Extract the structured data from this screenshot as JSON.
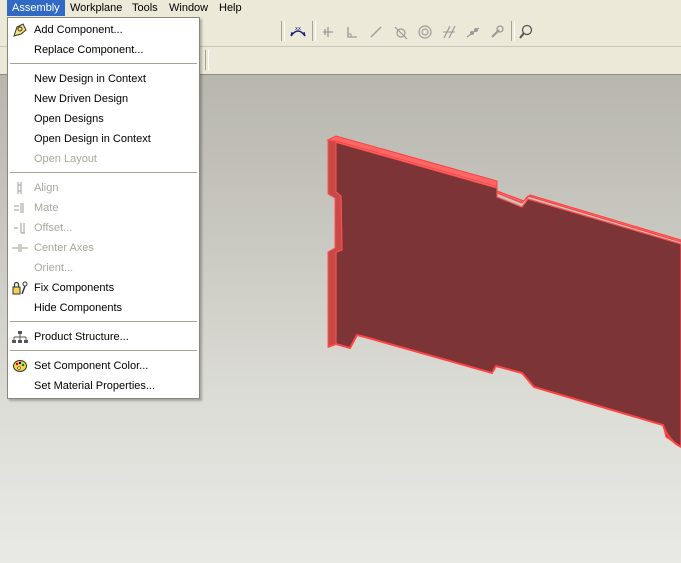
{
  "menubar": {
    "items": [
      {
        "label": "Assembly"
      },
      {
        "label": "Workplane"
      },
      {
        "label": "Tools"
      },
      {
        "label": "Window"
      },
      {
        "label": "Help"
      }
    ]
  },
  "assembly_menu": {
    "items": [
      {
        "label": "Add Component...",
        "enabled": true,
        "icon": "add-component-icon"
      },
      {
        "label": "Replace Component...",
        "enabled": true
      },
      {
        "label": "New Design in Context",
        "enabled": true
      },
      {
        "label": "New Driven Design",
        "enabled": true
      },
      {
        "label": "Open Designs",
        "enabled": true
      },
      {
        "label": "Open Design in Context",
        "enabled": true
      },
      {
        "label": "Open Layout",
        "enabled": false
      },
      {
        "label": "Align",
        "enabled": false,
        "icon": "align-icon"
      },
      {
        "label": "Mate",
        "enabled": false,
        "icon": "mate-icon"
      },
      {
        "label": "Offset...",
        "enabled": false,
        "icon": "offset-icon"
      },
      {
        "label": "Center Axes",
        "enabled": false,
        "icon": "center-axes-icon"
      },
      {
        "label": "Orient...",
        "enabled": false
      },
      {
        "label": "Fix Components",
        "enabled": true,
        "icon": "fix-components-icon"
      },
      {
        "label": "Hide Components",
        "enabled": true
      },
      {
        "label": "Product Structure...",
        "enabled": true,
        "icon": "product-structure-icon"
      },
      {
        "label": "Set Component Color...",
        "enabled": true,
        "icon": "color-palette-icon"
      },
      {
        "label": "Set Material Properties...",
        "enabled": true
      }
    ]
  },
  "toolbar": {
    "icons": [
      "dimension-icon",
      "horizontal-constraint-icon",
      "perpendicular-constraint-icon",
      "angle-constraint-icon",
      "tangent-constraint-icon",
      "concentric-constraint-icon",
      "parallel-constraint-icon",
      "coincident-constraint-icon",
      "fix-constraint-icon",
      "zoom-icon"
    ]
  },
  "colors": {
    "menu_highlight": "#316ac5",
    "part_face": "#7d3436",
    "part_edge": "#ff5050",
    "disabled_text": "#a8a69c"
  }
}
